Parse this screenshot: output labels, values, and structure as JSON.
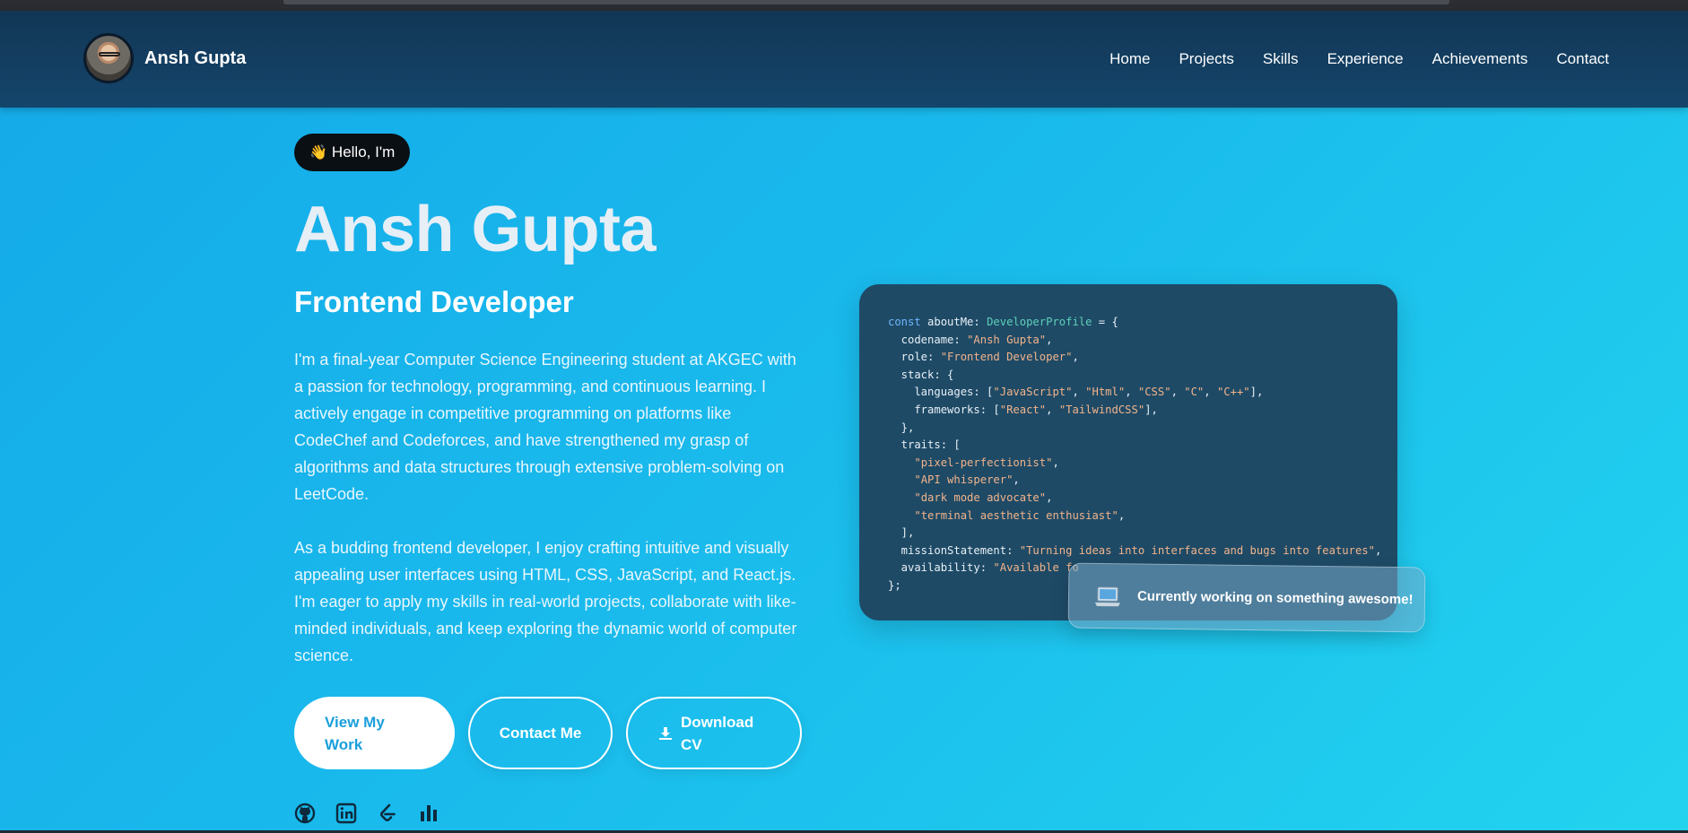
{
  "brand": {
    "name": "Ansh Gupta"
  },
  "nav": {
    "items": [
      "Home",
      "Projects",
      "Skills",
      "Experience",
      "Achievements",
      "Contact"
    ]
  },
  "hero": {
    "greeting": "Hello, I'm",
    "greeting_icon": "waving-hand-icon",
    "name": "Ansh Gupta",
    "role": "Frontend Developer",
    "bio_paragraph_1": "I'm a final-year Computer Science Engineering student at AKGEC with a passion for technology, programming, and continuous learning. I actively engage in competitive programming on platforms like CodeChef and Codeforces, and have strengthened my grasp of algorithms and data structures through extensive problem-solving on LeetCode.",
    "bio_paragraph_2": "As a budding frontend developer, I enjoy crafting intuitive and visually appealing user interfaces using HTML, CSS, JavaScript, and React.js. I'm eager to apply my skills in real-world projects, collaborate with like-minded individuals, and keep exploring the dynamic world of computer science.",
    "buttons": {
      "view_work": "View My Work",
      "contact": "Contact Me",
      "download_cv": "Download CV"
    },
    "socials": [
      "github-icon",
      "linkedin-icon",
      "leetcode-icon",
      "codechef-bar-icon"
    ]
  },
  "code_card": {
    "line1_kw": "const",
    "line1_var": " aboutMe: ",
    "line1_type": "DeveloperProfile",
    "line1_end": " = {",
    "codename_key": "  codename: ",
    "codename_val": "\"Ansh Gupta\"",
    "role_key": "  role: ",
    "role_val": "\"Frontend Developer\"",
    "stack_open": "  stack: {",
    "languages_key": "    languages: [",
    "languages": [
      "\"JavaScript\"",
      "\"Html\"",
      "\"CSS\"",
      "\"C\"",
      "\"C++\""
    ],
    "frameworks_key": "    frameworks: [",
    "frameworks": [
      "\"React\"",
      "\"TailwindCSS\""
    ],
    "stack_close": "  },",
    "traits_open": "  traits: [",
    "traits": [
      "\"pixel-perfectionist\"",
      "\"API whisperer\"",
      "\"dark mode advocate\"",
      "\"terminal aesthetic enthusiast\""
    ],
    "traits_close": "  ],",
    "mission_key": "  missionStatement: ",
    "mission_val": "\"Turning ideas into interfaces and bugs into features\"",
    "availability_key": "  availability: ",
    "availability_val": "\"Available fo",
    "close": "};"
  },
  "status": {
    "icon": "laptop-icon",
    "text": "Currently working on something awesome!"
  },
  "colors": {
    "navbar": "#123655",
    "accent": "#1a9fdc",
    "code_bg": "#1e4a66",
    "code_string": "#f2b38a",
    "code_keyword": "#6fb6ff",
    "code_type": "#5fd0b8"
  }
}
